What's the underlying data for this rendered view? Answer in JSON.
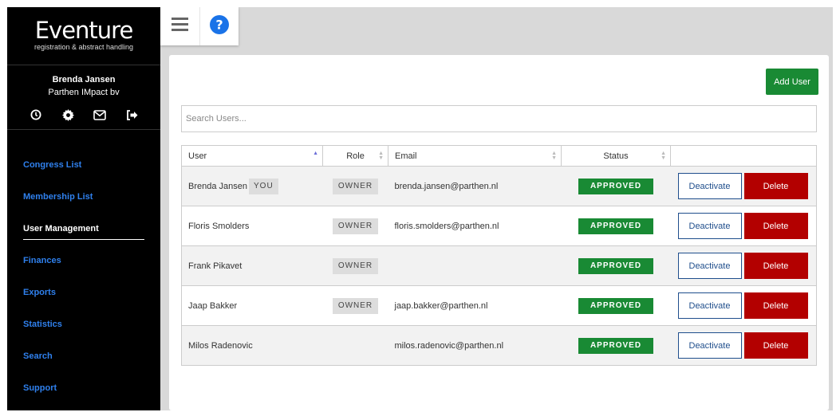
{
  "app": {
    "logo_title": "Eventure",
    "logo_subtitle": "registration & abstract handling"
  },
  "profile": {
    "name": "Brenda Jansen",
    "organization": "Parthen IMpact bv",
    "icons": [
      "clock-icon",
      "gear-icon",
      "envelope-icon",
      "sign-out-icon"
    ]
  },
  "nav": {
    "items": [
      {
        "label": "Congress List",
        "active": false
      },
      {
        "label": "Membership List",
        "active": false
      },
      {
        "label": "User Management",
        "active": true
      },
      {
        "label": "Finances",
        "active": false
      },
      {
        "label": "Exports",
        "active": false
      },
      {
        "label": "Statistics",
        "active": false
      },
      {
        "label": "Search",
        "active": false
      },
      {
        "label": "Support",
        "active": false
      }
    ]
  },
  "toolbar": {
    "menu_icon": "hamburger-icon",
    "help_icon": "question-circle-icon"
  },
  "main": {
    "add_user_label": "Add User",
    "search_placeholder": "Search Users...",
    "search_value": "",
    "columns": [
      "User",
      "Role",
      "Email",
      "Status",
      ""
    ],
    "you_label": "YOU",
    "deactivate_label": "Deactivate",
    "delete_label": "Delete",
    "users": [
      {
        "name": "Brenda Jansen",
        "is_you": true,
        "role": "OWNER",
        "email": "brenda.jansen@parthen.nl",
        "status": "APPROVED"
      },
      {
        "name": "Floris Smolders",
        "is_you": false,
        "role": "OWNER",
        "email": "floris.smolders@parthen.nl",
        "status": "APPROVED"
      },
      {
        "name": "Frank Pikavet",
        "is_you": false,
        "role": "OWNER",
        "email": "",
        "status": "APPROVED"
      },
      {
        "name": "Jaap Bakker",
        "is_you": false,
        "role": "OWNER",
        "email": "jaap.bakker@parthen.nl",
        "status": "APPROVED"
      },
      {
        "name": "Milos Radenovic",
        "is_you": false,
        "role": "",
        "email": "milos.radenovic@parthen.nl",
        "status": "APPROVED"
      }
    ]
  },
  "colors": {
    "accent_green": "#198a34",
    "delete_red": "#b30000",
    "nav_blue": "#2f80ed",
    "help_blue": "#1a73e8"
  }
}
